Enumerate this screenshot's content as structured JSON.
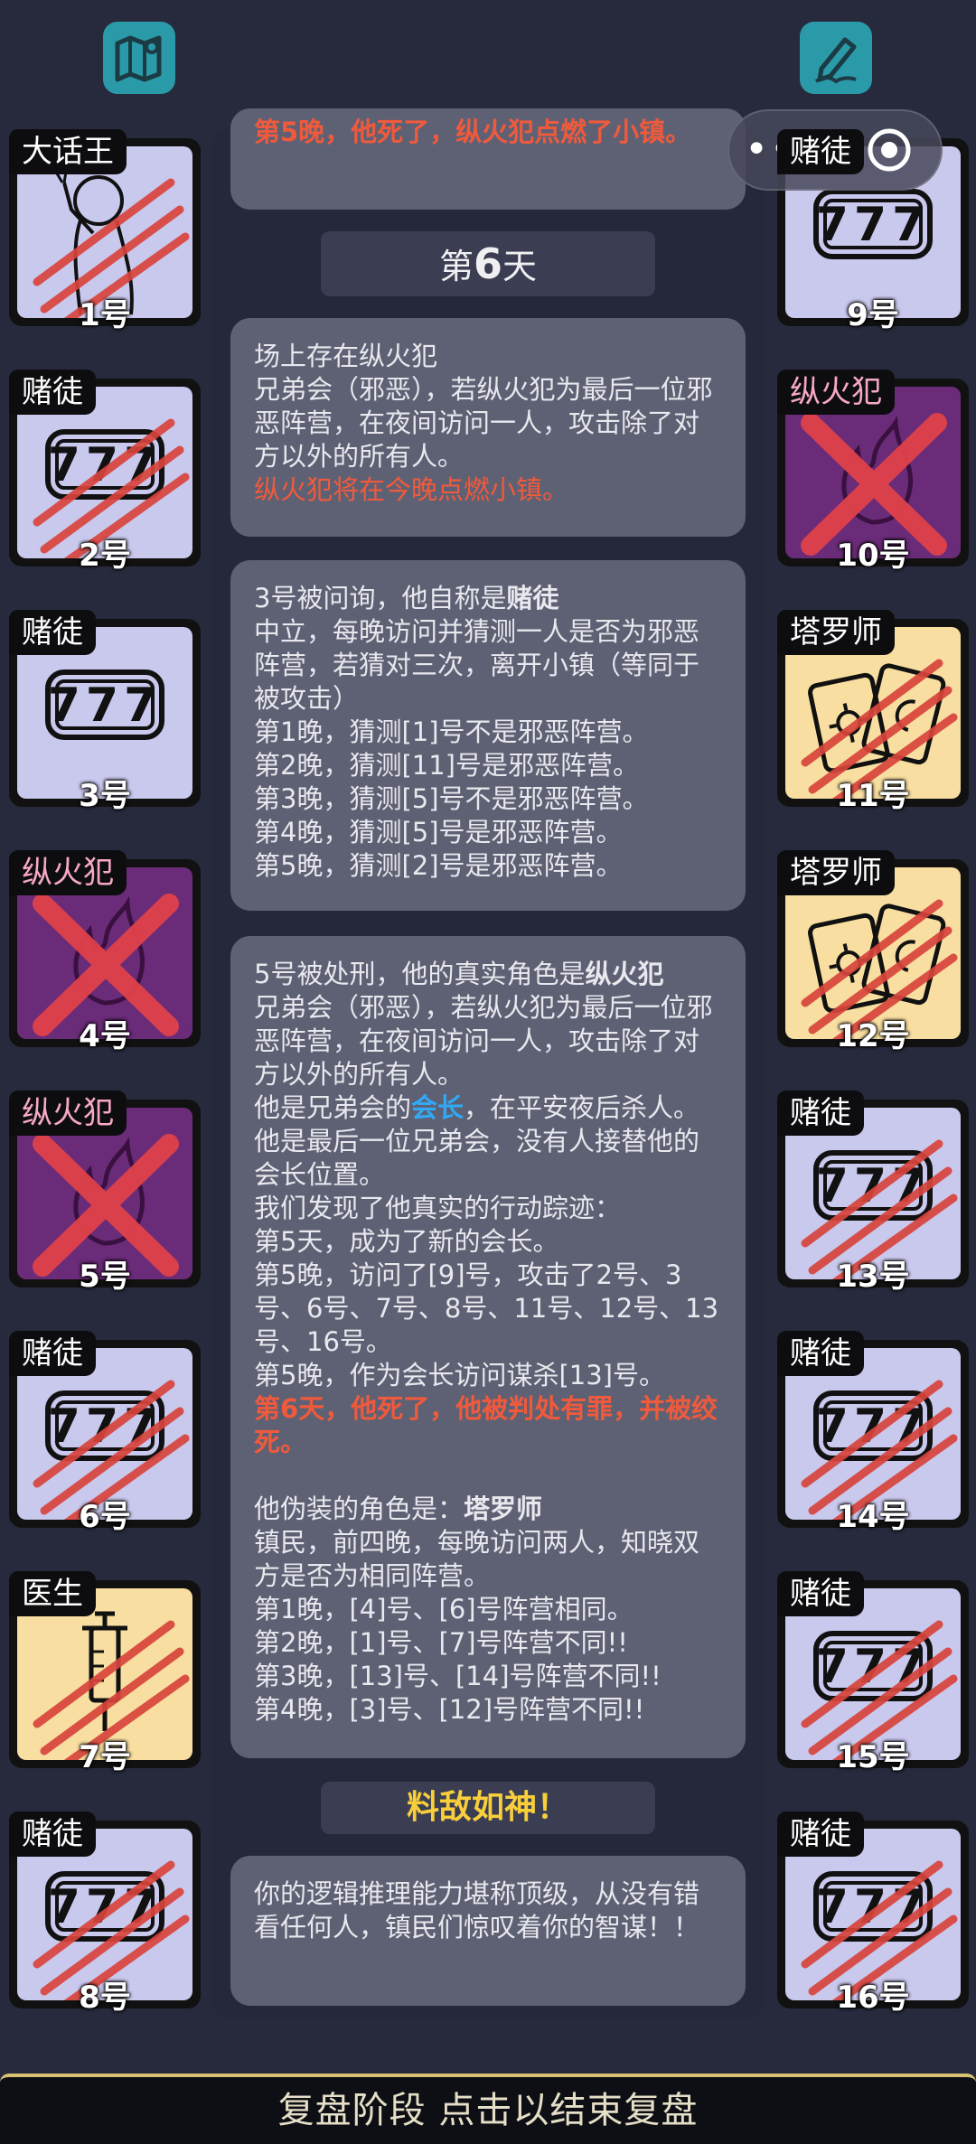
{
  "top_left_icon": "map-icon",
  "top_right_icon": "pen-icon",
  "capsule": {
    "menu": "•••",
    "close_icon": "target-icon"
  },
  "left_players": [
    {
      "role": "大话王",
      "number": "1号",
      "art": "liar",
      "slashed": true,
      "crossed": false,
      "evil": false,
      "bg": "#c9c8ed"
    },
    {
      "role": "赌徒",
      "number": "2号",
      "art": "777",
      "slashed": true,
      "crossed": false,
      "evil": false,
      "bg": "#c9c8ed"
    },
    {
      "role": "赌徒",
      "number": "3号",
      "art": "777",
      "slashed": false,
      "crossed": false,
      "evil": false,
      "bg": "#c9c8ed"
    },
    {
      "role": "纵火犯",
      "number": "4号",
      "art": "fire",
      "slashed": false,
      "crossed": true,
      "evil": true,
      "bg": "#6a2b78"
    },
    {
      "role": "纵火犯",
      "number": "5号",
      "art": "fire",
      "slashed": false,
      "crossed": true,
      "evil": true,
      "bg": "#6a2b78"
    },
    {
      "role": "赌徒",
      "number": "6号",
      "art": "777",
      "slashed": true,
      "crossed": false,
      "evil": false,
      "bg": "#c9c8ed"
    },
    {
      "role": "医生",
      "number": "7号",
      "art": "syringe",
      "slashed": true,
      "crossed": false,
      "evil": false,
      "bg": "#f8dea0"
    },
    {
      "role": "赌徒",
      "number": "8号",
      "art": "777",
      "slashed": true,
      "crossed": false,
      "evil": false,
      "bg": "#c9c8ed"
    }
  ],
  "right_players": [
    {
      "role": "赌徒",
      "number": "9号",
      "art": "777",
      "slashed": false,
      "crossed": false,
      "evil": false,
      "bg": "#c9c8ed"
    },
    {
      "role": "纵火犯",
      "number": "10号",
      "art": "fire",
      "slashed": false,
      "crossed": true,
      "evil": true,
      "bg": "#6a2b78"
    },
    {
      "role": "塔罗师",
      "number": "11号",
      "art": "tarot",
      "slashed": true,
      "crossed": false,
      "evil": false,
      "bg": "#f8dea0"
    },
    {
      "role": "塔罗师",
      "number": "12号",
      "art": "tarot",
      "slashed": true,
      "crossed": false,
      "evil": false,
      "bg": "#f8dea0"
    },
    {
      "role": "赌徒",
      "number": "13号",
      "art": "777",
      "slashed": true,
      "crossed": false,
      "evil": false,
      "bg": "#c9c8ed"
    },
    {
      "role": "赌徒",
      "number": "14号",
      "art": "777",
      "slashed": true,
      "crossed": false,
      "evil": false,
      "bg": "#c9c8ed"
    },
    {
      "role": "赌徒",
      "number": "15号",
      "art": "777",
      "slashed": true,
      "crossed": false,
      "evil": false,
      "bg": "#c9c8ed"
    },
    {
      "role": "赌徒",
      "number": "16号",
      "art": "777",
      "slashed": true,
      "crossed": false,
      "evil": false,
      "bg": "#c9c8ed"
    }
  ],
  "log": {
    "top_partial": "第5晚，他死了，纵火犯点燃了小镇。",
    "day_prefix": "第",
    "day_number": "6",
    "day_suffix": "天",
    "arsonist_box": {
      "line1": "场上存在纵火犯",
      "line2": "兄弟会（邪恶），若纵火犯为最后一位邪恶阵营，在夜间访问一人，攻击除了对方以外的所有人。",
      "line3": "纵火犯将在今晚点燃小镇。"
    },
    "gambler_box": {
      "head": "3号被问询，他自称是",
      "head_role": "赌徒",
      "desc": "中立，每晚访问并猜测一人是否为邪恶阵营，若猜对三次，离开小镇（等同于被攻击）",
      "guesses": [
        "第1晚，猜测[1]号不是邪恶阵营。",
        "第2晚，猜测[11]号是邪恶阵营。",
        "第3晚，猜测[5]号不是邪恶阵营。",
        "第4晚，猜测[5]号是邪恶阵营。",
        "第5晚，猜测[2]号是邪恶阵营。"
      ]
    },
    "execution_box": {
      "head": "5号被处刑，他的真实角色是",
      "head_role": "纵火犯",
      "desc": "兄弟会（邪恶），若纵火犯为最后一位邪恶阵营，在夜间访问一人，攻击除了对方以外的所有人。",
      "leader_pre": "他是兄弟会的",
      "leader_word": "会长",
      "leader_post": "，在平安夜后杀人。他是最后一位兄弟会，没有人接替他的会长位置。",
      "trace_title": "我们发现了他真实的行动踪迹：",
      "trace1": "第5天，成为了新的会长。",
      "trace2": "第5晚，访问了[9]号，攻击了2号、3号、6号、7号、8号、11号、12号、13号、16号。",
      "trace3": "第5晚，作为会长访问谋杀[13]号。",
      "death": "第6天，他死了，他被判处有罪，并被绞死。",
      "disguise_pre": "他伪装的角色是：",
      "disguise_role": "塔罗师",
      "disguise_desc": "镇民，前四晚，每晚访问两人，知晓双方是否为相同阵营。",
      "claims": [
        "第1晚，[4]号、[6]号阵营相同。",
        "第2晚，[1]号、[7]号阵营不同!!",
        "第3晚，[13]号、[14]号阵营不同!!",
        "第4晚，[3]号、[12]号阵营不同!!"
      ]
    },
    "praise_title": "料敌如神！",
    "praise_text": "你的逻辑推理能力堪称顶级，从没有错看任何人，镇民们惊叹着你的智谋！！"
  },
  "bottom_bar": "复盘阶段 点击以结束复盘",
  "colors": {
    "background": "#272a3d",
    "log_box": "#5e6174",
    "red_text": "#f05a3c",
    "blue_text": "#31a9f4",
    "gold_text": "#f8cf3b",
    "teal_icon": "#2a9aa8"
  }
}
